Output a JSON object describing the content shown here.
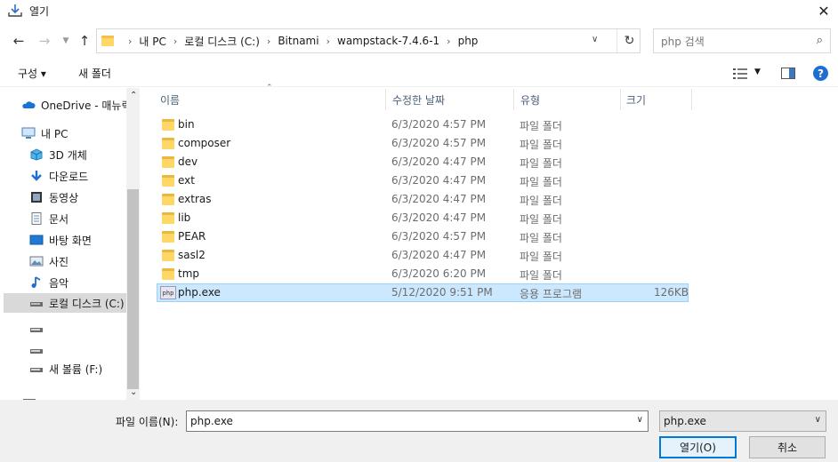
{
  "window": {
    "title": "열기",
    "close_icon": "close-icon"
  },
  "nav": {
    "back_icon": "arrow-left-icon",
    "forward_icon": "arrow-right-icon",
    "recent_icon": "chevron-down-icon",
    "up_icon": "arrow-up-icon"
  },
  "address": {
    "crumbs": [
      "내 PC",
      "로컬 디스크 (C:)",
      "Bitnami",
      "wampstack-7.4.6-1",
      "php"
    ]
  },
  "search": {
    "placeholder": "php 검색"
  },
  "toolbar": {
    "organize": "구성 ▾",
    "new_folder": "새 폴더"
  },
  "sidebar": {
    "items": [
      {
        "label": "OneDrive - 매뉴릭",
        "icon": "cloud-icon"
      },
      {
        "label": "내 PC",
        "icon": "computer-icon"
      },
      {
        "label": "3D 개체",
        "icon": "cube-icon"
      },
      {
        "label": "다운로드",
        "icon": "download-icon"
      },
      {
        "label": "동영상",
        "icon": "video-icon"
      },
      {
        "label": "문서",
        "icon": "document-icon"
      },
      {
        "label": "바탕 화면",
        "icon": "desktop-icon"
      },
      {
        "label": "사진",
        "icon": "picture-icon"
      },
      {
        "label": "음악",
        "icon": "music-icon"
      },
      {
        "label": "로컬 디스크 (C:)",
        "icon": "drive-icon"
      },
      {
        "label": "",
        "icon": "drive-icon"
      },
      {
        "label": "",
        "icon": "drive-icon"
      },
      {
        "label": "새 볼륨 (F:)",
        "icon": "drive-icon"
      }
    ]
  },
  "columns": {
    "name": "이름",
    "date": "수정한 날짜",
    "type": "유형",
    "size": "크기"
  },
  "files": [
    {
      "name": "bin",
      "date": "6/3/2020 4:57 PM",
      "type": "파일 폴더",
      "size": ""
    },
    {
      "name": "composer",
      "date": "6/3/2020 4:57 PM",
      "type": "파일 폴더",
      "size": ""
    },
    {
      "name": "dev",
      "date": "6/3/2020 4:47 PM",
      "type": "파일 폴더",
      "size": ""
    },
    {
      "name": "ext",
      "date": "6/3/2020 4:47 PM",
      "type": "파일 폴더",
      "size": ""
    },
    {
      "name": "extras",
      "date": "6/3/2020 4:47 PM",
      "type": "파일 폴더",
      "size": ""
    },
    {
      "name": "lib",
      "date": "6/3/2020 4:47 PM",
      "type": "파일 폴더",
      "size": ""
    },
    {
      "name": "PEAR",
      "date": "6/3/2020 4:57 PM",
      "type": "파일 폴더",
      "size": ""
    },
    {
      "name": "sasl2",
      "date": "6/3/2020 4:47 PM",
      "type": "파일 폴더",
      "size": ""
    },
    {
      "name": "tmp",
      "date": "6/3/2020 6:20 PM",
      "type": "파일 폴더",
      "size": ""
    },
    {
      "name": "php.exe",
      "date": "5/12/2020 9:51 PM",
      "type": "응용 프로그램",
      "size": "126KB",
      "selected": true
    }
  ],
  "footer": {
    "filename_label": "파일 이름(N):",
    "filename_value": "php.exe",
    "filetype_value": "php.exe",
    "open_button": "열기(O)",
    "cancel_button": "취소"
  }
}
